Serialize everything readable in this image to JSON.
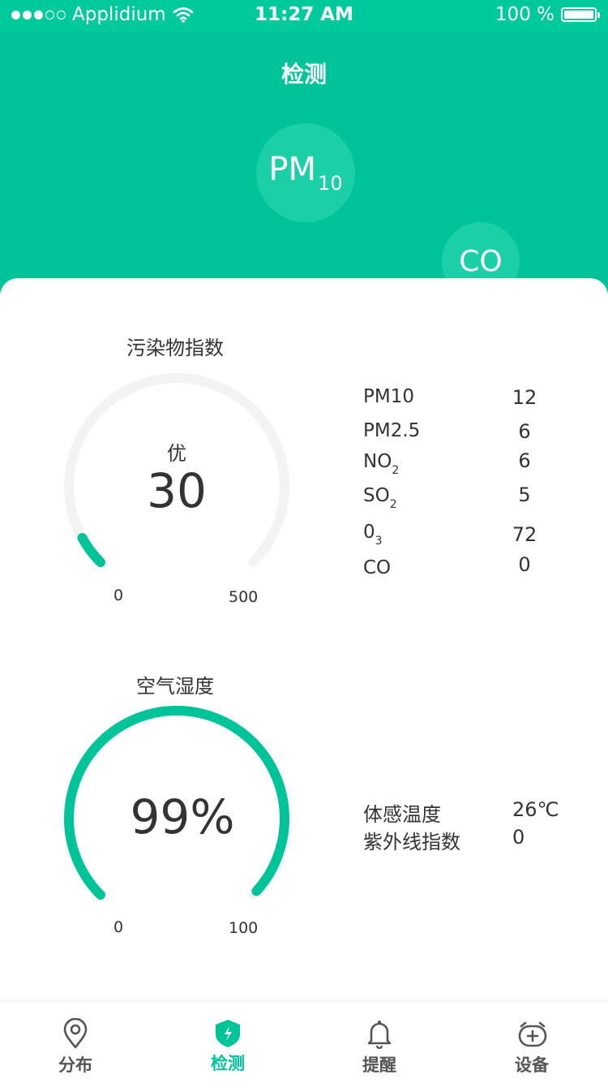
{
  "status_bar": {
    "carrier": "Applidium",
    "time": "11:27 AM",
    "battery": "100 %"
  },
  "header": {
    "title": "检测"
  },
  "bubbles": {
    "pm_main": "PM",
    "pm_sub": "10",
    "co": "CO"
  },
  "pollution": {
    "title": "污染物指数",
    "level": "优",
    "value": "30",
    "min_label": "0",
    "max_label": "500",
    "fraction": 0.06,
    "items": [
      {
        "name": "PM10",
        "sub": "",
        "value": "12"
      },
      {
        "name": "PM2.5",
        "sub": "",
        "value": "6"
      },
      {
        "name": "NO",
        "sub": "2",
        "value": "6"
      },
      {
        "name": "SO",
        "sub": "2",
        "value": "5"
      },
      {
        "name": "0",
        "sub": "3",
        "value": "72"
      },
      {
        "name": "CO",
        "sub": "",
        "value": "0"
      }
    ]
  },
  "humidity": {
    "title": "空气湿度",
    "value": "99%",
    "min_label": "0",
    "max_label": "100",
    "fraction": 0.99,
    "items": [
      {
        "name": "体感温度",
        "value": "26℃"
      },
      {
        "name": "紫外线指数",
        "value": "0"
      }
    ]
  },
  "tabbar": {
    "tabs": [
      {
        "label": "分布",
        "icon": "location-pin-icon"
      },
      {
        "label": "检测",
        "icon": "shield-bolt-icon",
        "active": true
      },
      {
        "label": "提醒",
        "icon": "bell-icon"
      },
      {
        "label": "设备",
        "icon": "device-robot-icon"
      }
    ]
  },
  "colors": {
    "accent": "#00c499",
    "track": "#f3f3f3",
    "bubble": "#1bd0a7"
  }
}
